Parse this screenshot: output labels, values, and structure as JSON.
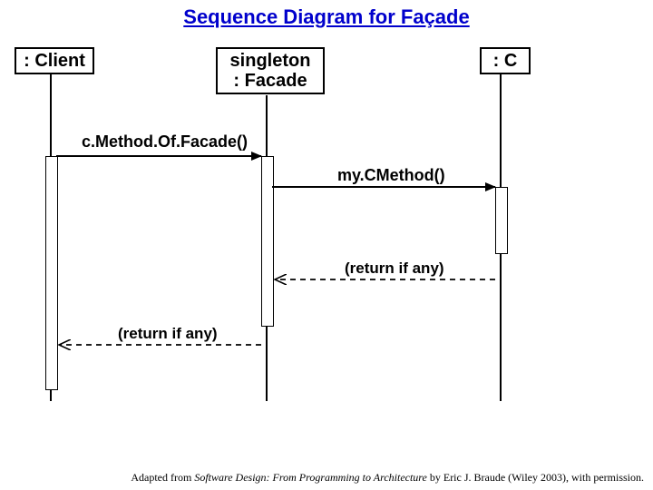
{
  "title": "Sequence Diagram for Façade",
  "roles": {
    "client": ": Client",
    "facade_line1": "singleton",
    "facade_line2": ": Facade",
    "c": ": C"
  },
  "messages": {
    "call1": "c.Method.Of.Facade()",
    "call2": "my.CMethod()",
    "return1": "(return if any)",
    "return2": "(return if any)"
  },
  "footer": {
    "prefix": "Adapted from ",
    "book": "Software Design: From Programming to Architecture",
    "suffix": " by Eric J. Braude (Wiley 2003), with permission."
  },
  "chart_data": {
    "type": "sequence-diagram",
    "title": "Sequence Diagram for Façade",
    "participants": [
      {
        "name": ": Client",
        "id": "client"
      },
      {
        "name": "singleton : Facade",
        "id": "facade"
      },
      {
        "name": ": C",
        "id": "c"
      }
    ],
    "messages": [
      {
        "from": "client",
        "to": "facade",
        "label": "c.Method.Of.Facade()",
        "kind": "call"
      },
      {
        "from": "facade",
        "to": "c",
        "label": "my.CMethod()",
        "kind": "call"
      },
      {
        "from": "c",
        "to": "facade",
        "label": "(return if any)",
        "kind": "return"
      },
      {
        "from": "facade",
        "to": "client",
        "label": "(return if any)",
        "kind": "return"
      }
    ]
  }
}
